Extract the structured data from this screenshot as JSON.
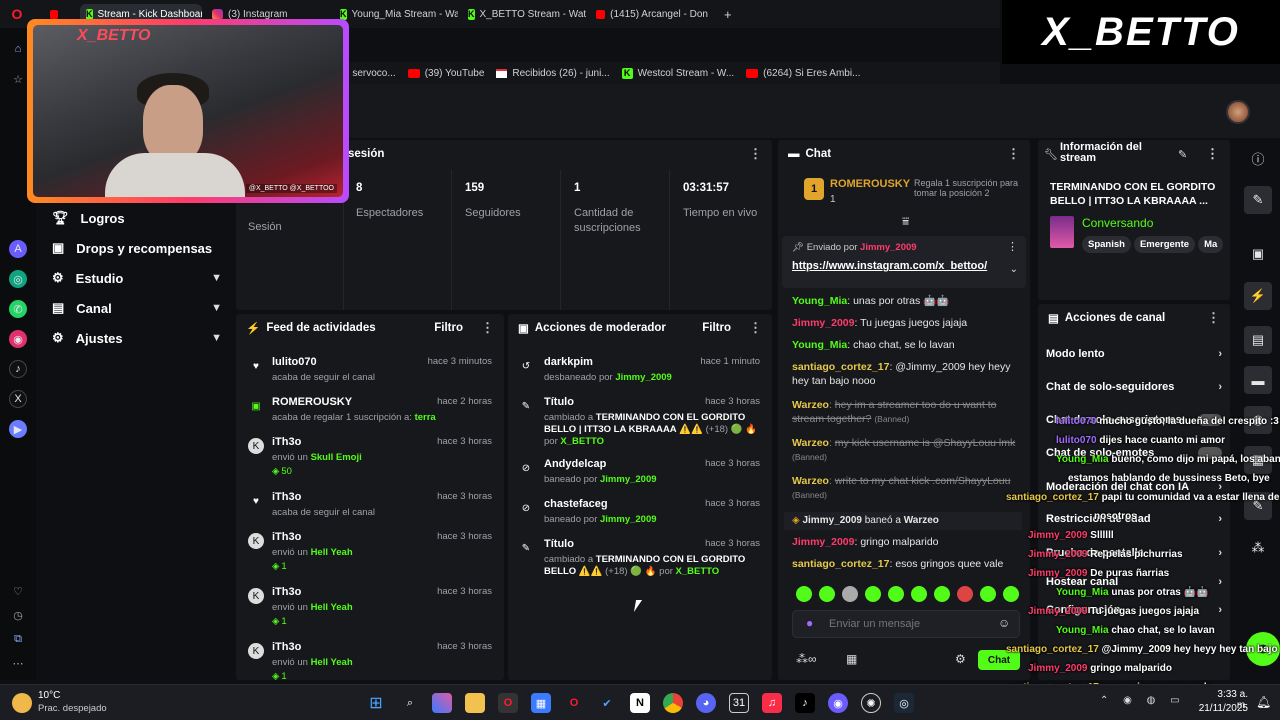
{
  "browser": {
    "tabs": [
      {
        "label": "Stream - Kick Dashboard",
        "icon": "kick-icon",
        "active": true
      },
      {
        "label": "(3) Instagram",
        "icon": "instagram-icon",
        "active": false
      },
      {
        "label": "Young_Mia Stream - Watc",
        "icon": "kick-icon",
        "active": false
      },
      {
        "label": "X_BETTO Stream - Watch",
        "icon": "kick-icon",
        "active": false
      },
      {
        "label": "(1415) Arcangel - Don",
        "icon": "youtube-icon",
        "active": false
      }
    ],
    "new_tab": "+",
    "bookmarks": [
      {
        "label": "e servoco...",
        "icon": ""
      },
      {
        "label": "(39) YouTube",
        "icon": "youtube-icon"
      },
      {
        "label": "Recibidos (26) - juni...",
        "icon": "gmail-icon"
      },
      {
        "label": "Westcol Stream - W...",
        "icon": "kick-icon"
      },
      {
        "label": "(6264) Si Eres Ambi...",
        "icon": "youtube-icon"
      }
    ]
  },
  "webcam": {
    "overlay_logo": "X_BETTO",
    "handle_tag": "@X_BETTO @X_BETTOO"
  },
  "brand_banner": "X_BETTO",
  "sidenav": {
    "items": [
      {
        "label": "Logros",
        "icon": "trophy-icon",
        "expandable": false
      },
      {
        "label": "Drops y recompensas",
        "icon": "gift-icon",
        "expandable": false
      },
      {
        "label": "Estudio",
        "icon": "gear-icon",
        "expandable": true
      },
      {
        "label": "Canal",
        "icon": "channel-icon",
        "expandable": true
      },
      {
        "label": "Ajustes",
        "icon": "gear-icon",
        "expandable": true
      }
    ]
  },
  "session": {
    "title": "sesión",
    "first_label": "Sesión",
    "stats": [
      {
        "value": "8",
        "label": "Espectadores"
      },
      {
        "value": "159",
        "label": "Seguidores"
      },
      {
        "value": "1",
        "label": "Cantidad de suscripciones"
      },
      {
        "value": "03:31:57",
        "label": "Tiempo en vivo"
      }
    ]
  },
  "activity_feed": {
    "title": "Feed de actividades",
    "filter": "Filtro",
    "items": [
      {
        "user": "lulito070",
        "text": "acaba de seguir el canal",
        "time": "hace 3 minutos",
        "icon": "heart-icon",
        "extra": ""
      },
      {
        "user": "ROMEROUSKY",
        "text": "acaba de regalar 1 suscripción a: terra",
        "time": "hace 2 horas",
        "icon": "gift-icon",
        "extra": ""
      },
      {
        "user": "iTh3o",
        "text": "envió un Skull Emoji",
        "time": "hace 3 horas",
        "icon": "kick-coin-icon",
        "extra": "50"
      },
      {
        "user": "iTh3o",
        "text": "acaba de seguir el canal",
        "time": "hace 3 horas",
        "icon": "heart-icon",
        "extra": ""
      },
      {
        "user": "iTh3o",
        "text": "envió un Hell Yeah",
        "time": "hace 3 horas",
        "icon": "kick-coin-icon",
        "extra": "1"
      },
      {
        "user": "iTh3o",
        "text": "envió un Hell Yeah",
        "time": "hace 3 horas",
        "icon": "kick-coin-icon",
        "extra": "1"
      },
      {
        "user": "iTh3o",
        "text": "envió un Hell Yeah",
        "time": "hace 3 horas",
        "icon": "kick-coin-icon",
        "extra": "1"
      }
    ]
  },
  "mod_actions": {
    "title": "Acciones de moderador",
    "filter": "Filtro",
    "items": [
      {
        "title": "darkkpim",
        "text": "desbaneado por Jimmy_2009",
        "time": "hace 1 minuto",
        "icon": "undo-icon"
      },
      {
        "title": "Título",
        "text": "cambiado a TERMINANDO CON EL GORDITO BELLO | ITT3O LA KBRAAAA ⚠️⚠️ (+18) 🟢 🔥 por X_BETTO",
        "time": "hace 3 horas",
        "icon": "edit-title-icon"
      },
      {
        "title": "Andydelcap",
        "text": "baneado por Jimmy_2009",
        "time": "hace 3 horas",
        "icon": "ban-icon"
      },
      {
        "title": "chastefaceg",
        "text": "baneado por Jimmy_2009",
        "time": "hace 3 horas",
        "icon": "ban-icon"
      },
      {
        "title": "Título",
        "text": "cambiado a TERMINANDO CON EL GORDITO BELLO ⚠️⚠️ (+18) 🟢 🔥 por X_BETTO",
        "time": "hace 3 horas",
        "icon": "edit-title-icon"
      }
    ]
  },
  "chat": {
    "title": "Chat",
    "leader": {
      "name": "ROMEROUSKY",
      "count": "1",
      "cta": "Regala 1 suscripción para tomar la posición 2"
    },
    "pinned": {
      "label": "Enviado por",
      "user": "Jimmy_2009",
      "link": "https://www.instagram.com/x_bettoo/"
    },
    "messages": [
      {
        "user": "Young_Mia",
        "text": "unas por otras 🤖🤖",
        "color": "#53fc18",
        "note": ""
      },
      {
        "user": "Jimmy_2009",
        "text": "Tu juegas juegos jajaja",
        "color": "#ff3b6b",
        "note": ""
      },
      {
        "user": "Young_Mia",
        "text": "chao chat, se lo lavan",
        "color": "#53fc18",
        "note": ""
      },
      {
        "user": "santiago_cortez_17",
        "text": "@Jimmy_2009 hey heyy hey tan bajo nooo",
        "color": "#e6c84a",
        "note": ""
      },
      {
        "user": "Warzeo",
        "text": "hey im a streamer too do u want to stream together?",
        "color": "#e6c84a",
        "note": "(Banned)"
      },
      {
        "user": "Warzeo",
        "text": "my kick username is @ShayyLouu lmk",
        "color": "#e6c84a",
        "note": "(Banned)"
      },
      {
        "user": "Warzeo",
        "text": "write to my chat kick .com/ShayyLouu",
        "color": "#e6c84a",
        "note": "(Banned)"
      },
      {
        "user": "Jimmy_2009",
        "text": "gringo malparido",
        "color": "#ff3b6b",
        "note": ""
      },
      {
        "user": "santiago_cortez_17",
        "text": "esos gringos quee vale",
        "color": "#e6c84a",
        "note": ""
      }
    ],
    "ban_notice": {
      "actor": "Jimmy_2009",
      "verb": "baneó a",
      "target": "Warzeo"
    },
    "input_placeholder": "Enviar un mensaje",
    "send_label": "Chat"
  },
  "stream_info": {
    "title": "Información del stream",
    "stream_title": "TERMINANDO CON EL GORDITO BELLO | ITT3O LA KBRAAAA ...",
    "category": "Conversando",
    "tags": [
      "Spanish",
      "Emergente",
      "Ma"
    ]
  },
  "channel_actions": {
    "title": "Acciones de canal",
    "items": [
      {
        "label": "Modo lento",
        "type": "chevron"
      },
      {
        "label": "Chat de solo-seguidores",
        "type": "chevron"
      },
      {
        "label": "Chat de solo-suscriptores",
        "type": "toggle"
      },
      {
        "label": "Chat de solo-emotes",
        "type": "toggle"
      },
      {
        "label": "Moderación del chat con IA",
        "type": "chevron"
      },
      {
        "label": "Restricción de edad",
        "type": "chevron"
      },
      {
        "label": "Prueba de pantalla",
        "type": "chevron"
      },
      {
        "label": "Hostear canal",
        "type": "chevron"
      },
      {
        "label": "Configuración",
        "type": "chevron"
      }
    ]
  },
  "overlay_chat": [
    {
      "user": "lulito070",
      "text": "mucho gusto, la dueña del crespito :3",
      "color": "#a06bff"
    },
    {
      "user": "lulito070",
      "text": "dijes hace cuanto mi amor",
      "color": "#a06bff"
    },
    {
      "user": "Young_Mia",
      "text": "bueno, como dijo mi papá, los abandono",
      "color": "#53fc18"
    },
    {
      "user": "",
      "text": "estamos hablando de bussiness Beto, bye",
      "color": "#ffffff"
    },
    {
      "user": "santiago_cortez_17",
      "text": "papi tu comunidad va a estar llena de ge",
      "color": "#e6c84a"
    },
    {
      "user": "",
      "text": "nosotros",
      "color": "#ffffff"
    },
    {
      "user": "Jimmy_2009",
      "text": "Sllllll",
      "color": "#ff3b6b"
    },
    {
      "user": "Jimmy_2009",
      "text": "Re pelas pichurrias",
      "color": "#ff3b6b"
    },
    {
      "user": "Jimmy_2009",
      "text": "De puras ñarrias",
      "color": "#ff3b6b"
    },
    {
      "user": "Young_Mia",
      "text": "unas por otras 🤖🤖",
      "color": "#53fc18"
    },
    {
      "user": "Jimmy_2009",
      "text": "Tu juegas juegos jajaja",
      "color": "#ff3b6b"
    },
    {
      "user": "Young_Mia",
      "text": "chao chat, se lo lavan",
      "color": "#53fc18"
    },
    {
      "user": "santiago_cortez_17",
      "text": "@Jimmy_2009 hey heyy hey tan bajo no",
      "color": "#e6c84a"
    },
    {
      "user": "Jimmy_2009",
      "text": "gringo malparido",
      "color": "#ff3b6b"
    },
    {
      "user": "santiago_cortez_17",
      "text": "esos gringos quee vale",
      "color": "#e6c84a"
    }
  ],
  "taskbar": {
    "weather_temp": "10°C",
    "weather_desc": "Prac. despejado",
    "time": "3:33 a. m.",
    "date": "21/11/2025"
  },
  "colors": {
    "kick_green": "#53fc18",
    "panel": "#17181c",
    "bg": "#0e0f12"
  }
}
